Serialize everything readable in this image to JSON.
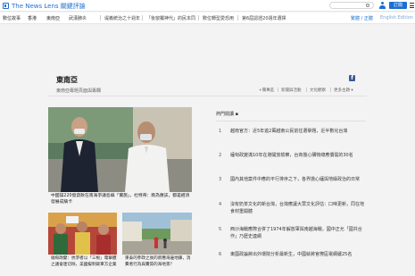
{
  "header": {
    "logo_text": "The News Lens 關鍵評論",
    "subscribe_label": "訂閱"
  },
  "nav": {
    "items": [
      "數位故事",
      "香港",
      "東南亞",
      "武漢肺炎"
    ],
    "headlines": [
      "堤義統治之十週年",
      "「後窗獨神代」的民本同",
      "數位轉型愛恐用",
      "第6屆認證20週年選擇"
    ],
    "lang_zh": "繁體 / 正體",
    "lang_en": "English Edition"
  },
  "section": {
    "title": "東南亞",
    "description": "東南亞專題頁面與專欄",
    "filters": [
      "+關專區",
      "新聞與活動",
      "文化觀察",
      "更多主題 ▾"
    ]
  },
  "lead": {
    "caption": "中國操220億貸款在南海爭議島嶼「實施」，杜特蒂：兩為應該，都是經濟發展成績卡"
  },
  "thumbs": [
    {
      "caption": "緬甸政變：抗爭者以「三根」電擊體之議會連切除，美國擬制裁軍方企業"
    },
    {
      "caption": "柬泰的參政之後的新應海邊地鍊，消費者行為與實質的海地景？"
    }
  ],
  "ranking": {
    "title": "熱門閱讀 ▪",
    "items": [
      {
        "num": "1",
        "text": "越南官方：近5年逾2萬越南公民前往選擧題，近半數化台灣"
      },
      {
        "num": "2",
        "text": "緬甸政變滿10年在港開放檢察，台商擔心購物總應價需的30名"
      },
      {
        "num": "3",
        "text": "國內其他案件中應的平行排序之下，各界擔心緬與地緣政治的日常"
      },
      {
        "num": "4",
        "text": "沒有奶茶文化的新台灣，台灣應讓大眾文化評估：口味更新，同在地食材重開體"
      },
      {
        "num": "5",
        "text": "西沙海戰應際合併了1974年解放軍與南越海戰，國中正允「國共合作」乃歷史連網"
      },
      {
        "num": "6",
        "text": "東國政論將出外環院分析最新生，中國就將官僚區電網緩25名"
      }
    ]
  }
}
